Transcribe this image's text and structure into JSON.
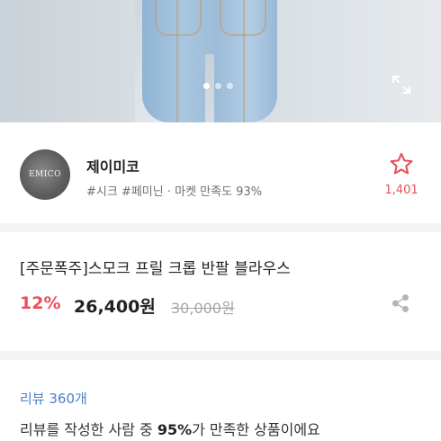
{
  "product_image": {
    "slide_count": 3,
    "active_slide": 1,
    "expand_icon": "expand-icon"
  },
  "seller": {
    "logo_text": "EMICO",
    "name": "제이미코",
    "tags": "#시크 #페미닌 · 마켓 만족도 93%",
    "favorite_icon": "star-outline-icon",
    "favorite_count": "1,401",
    "accent_color": "#e8505b"
  },
  "product": {
    "title": "[주문폭주]스모크 프릴 크롭 반팔 블라우스",
    "discount": "12%",
    "price": "26,400원",
    "original_price": "30,000원",
    "share_icon": "share-icon"
  },
  "review": {
    "link_label": "리뷰 360개",
    "summary_prefix": "리뷰를 작성한 사람 중 ",
    "summary_percent": "95%",
    "summary_suffix": "가 만족한 상품이에요",
    "link_color": "#4a7fc9"
  }
}
